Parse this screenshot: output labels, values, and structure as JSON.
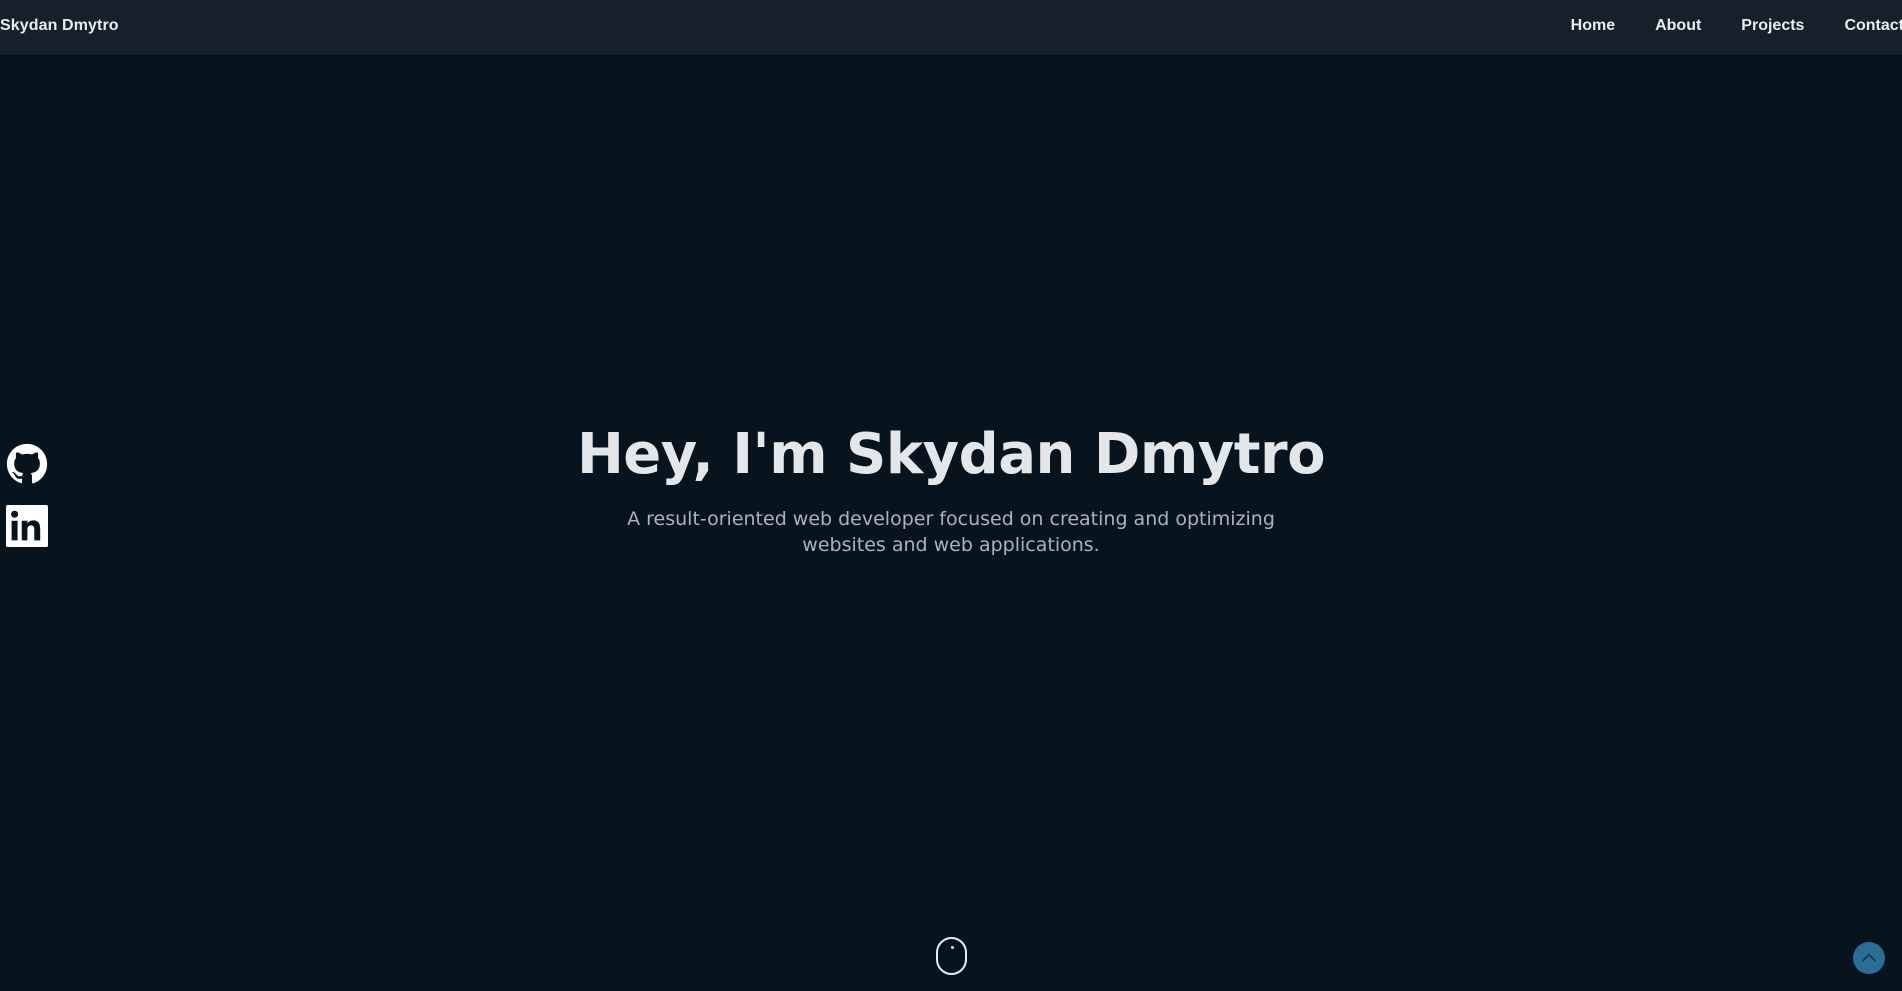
{
  "header": {
    "brand": "Skydan Dmytro",
    "nav": {
      "home": "Home",
      "about": "About",
      "projects": "Projects",
      "contact": "Contact"
    }
  },
  "socials": [
    {
      "icon": "github-icon"
    },
    {
      "icon": "linkedin-icon"
    }
  ],
  "hero": {
    "title": "Hey, I'm Skydan Dmytro",
    "subtitle": "A result-oriented web developer focused on creating and optimizing websites and web applications."
  },
  "controls": {
    "scroll_indicator_icon": "mouse-scroll-icon",
    "scroll_top_icon": "chevron-up-icon"
  },
  "colors": {
    "background": "#08141d",
    "header_background": "#15202a",
    "text_primary": "#e4e7ea",
    "text_secondary": "#aab3bb",
    "accent": "#2a6e95"
  }
}
